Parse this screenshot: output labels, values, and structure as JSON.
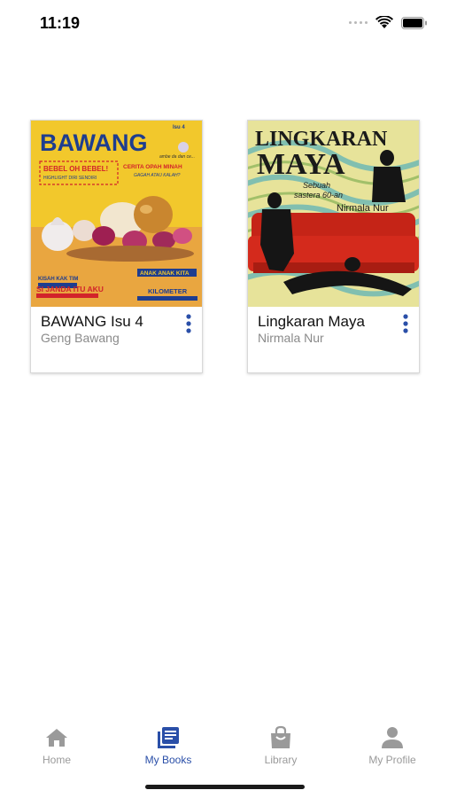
{
  "status_bar": {
    "time": "11:19"
  },
  "books": [
    {
      "title": "BAWANG Isu 4",
      "author": "Geng Bawang",
      "cover": {
        "masthead": "BAWANG",
        "issue": "Isu 4",
        "tagline": "ambe da dan ce...",
        "headline_1": "BEBEL OH BEBEL!",
        "headline_1_sub": "HIGHLIGHT DIRI SENDIRI",
        "headline_2": "CERITA OPAH MINAH",
        "headline_2_sub": "GAGAH ATAU KALAH?",
        "headline_3": "KISAH KAK TIM",
        "headline_4": "SI JANDA ITU AKU",
        "headline_5": "ANAK ANAK KITA",
        "headline_6": "KILOMETER"
      }
    },
    {
      "title": "Lingkaran Maya",
      "author": "Nirmala Nur",
      "cover": {
        "title_line_1": "LINGKARAN",
        "title_line_2": "MAYA",
        "subtitle_1": "Sebuah",
        "subtitle_2": "sastera 60-an",
        "author": "Nirmala Nur"
      }
    }
  ],
  "tabs": [
    {
      "label": "Home",
      "icon": "home-icon",
      "active": false
    },
    {
      "label": "My Books",
      "icon": "books-icon",
      "active": true
    },
    {
      "label": "Library",
      "icon": "library-bag-icon",
      "active": false
    },
    {
      "label": "My Profile",
      "icon": "person-icon",
      "active": false
    }
  ],
  "colors": {
    "accent": "#2a4fa8",
    "inactive": "#9a9a9a",
    "bawang_yellow": "#f2c82c",
    "bawang_blue": "#1e3d8f",
    "maya_red": "#d42a1c"
  }
}
